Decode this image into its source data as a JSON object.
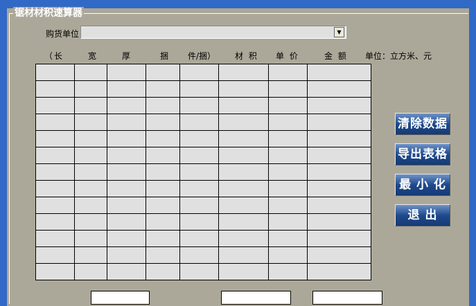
{
  "title": "锯材材积速算器",
  "buyer": {
    "label": "购货单位",
    "value": ""
  },
  "headers": [
    "（长",
    "宽",
    "厚",
    "捆",
    "件/捆）",
    "材 积",
    "单 价",
    "金 额"
  ],
  "unit_note": "单位：立方米、元",
  "buttons": {
    "clear": "清除数据",
    "export": "导出表格",
    "minimize": "最 小 化",
    "exit": "退 出"
  },
  "row_count": 13
}
